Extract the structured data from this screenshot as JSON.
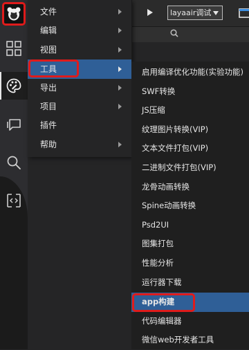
{
  "toolbar": {
    "run_target": "layaair调试"
  },
  "activity_bar": {
    "icons": [
      "layaair-logo-icon",
      "grid-icon",
      "palette-icon",
      "chat-icon",
      "search-icon",
      "code-icon"
    ]
  },
  "menu": {
    "items": [
      {
        "label": "文件",
        "has_submenu": true
      },
      {
        "label": "编辑",
        "has_submenu": true
      },
      {
        "label": "视图",
        "has_submenu": true
      },
      {
        "label": "工具",
        "has_submenu": true,
        "selected": true
      },
      {
        "label": "导出",
        "has_submenu": true
      },
      {
        "label": "项目",
        "has_submenu": true
      },
      {
        "label": "插件",
        "has_submenu": false
      },
      {
        "label": "帮助",
        "has_submenu": true
      }
    ]
  },
  "tools_submenu": {
    "items": [
      {
        "label": "启用编译优化功能(实验功能)"
      },
      {
        "label": "SWF转换"
      },
      {
        "label": "JS压缩"
      },
      {
        "label": "纹理图片转换(VIP)"
      },
      {
        "label": "文本文件打包(VIP)"
      },
      {
        "label": "二进制文件打包(VIP)"
      },
      {
        "label": "龙骨动画转换"
      },
      {
        "label": "Spine动画转换"
      },
      {
        "label": "Psd2UI"
      },
      {
        "label": "图集打包"
      },
      {
        "label": "性能分析"
      },
      {
        "label": "运行器下载"
      },
      {
        "label": "app构建",
        "selected": true
      },
      {
        "label": "代码编辑器"
      },
      {
        "label": "微信web开发者工具"
      }
    ]
  },
  "colors": {
    "highlight": "#e01b1b",
    "selection": "#2f5f97"
  }
}
